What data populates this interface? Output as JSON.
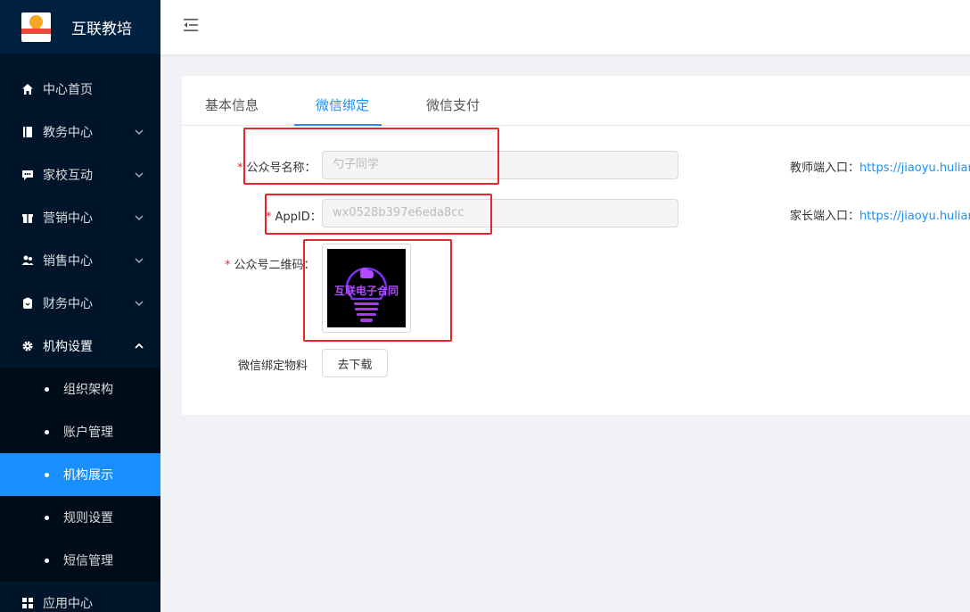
{
  "brand": {
    "title": "互联教培",
    "logo_text": "互联教培"
  },
  "sidebar": {
    "items": [
      {
        "label": "中心首页",
        "icon": "home-icon"
      },
      {
        "label": "教务中心",
        "icon": "book-icon"
      },
      {
        "label": "家校互动",
        "icon": "chat-icon"
      },
      {
        "label": "营销中心",
        "icon": "gift-icon"
      },
      {
        "label": "销售中心",
        "icon": "user-group-icon"
      },
      {
        "label": "财务中心",
        "icon": "wallet-icon"
      },
      {
        "label": "机构设置",
        "icon": "gear-icon"
      }
    ],
    "sub_items": [
      {
        "label": "组织架构"
      },
      {
        "label": "账户管理"
      },
      {
        "label": "机构展示"
      },
      {
        "label": "规则设置"
      },
      {
        "label": "短信管理"
      }
    ],
    "last_item": {
      "label": "应用中心",
      "icon": "apps-icon"
    }
  },
  "tabs": [
    {
      "label": "基本信息"
    },
    {
      "label": "微信绑定"
    },
    {
      "label": "微信支付"
    }
  ],
  "form": {
    "name_label": "公众号名称：",
    "name_placeholder": "勺子同学",
    "appid_label": "AppID：",
    "appid_placeholder": "wx0528b397e6eda8cc",
    "qr_label": "公众号二维码：",
    "qr_text": "互联电子合同",
    "material_label": "微信绑定物料",
    "download_button": "去下载",
    "required_mark": "*"
  },
  "links": {
    "teacher_label": "教师端入口：",
    "teacher_url": "https://jiaoyu.huliar",
    "parent_label": "家长端入口：",
    "parent_url": "https://jiaoyu.huliar"
  },
  "colors": {
    "accent": "#1890ff",
    "sidebar": "#001529",
    "annotation": "#e5262a"
  }
}
